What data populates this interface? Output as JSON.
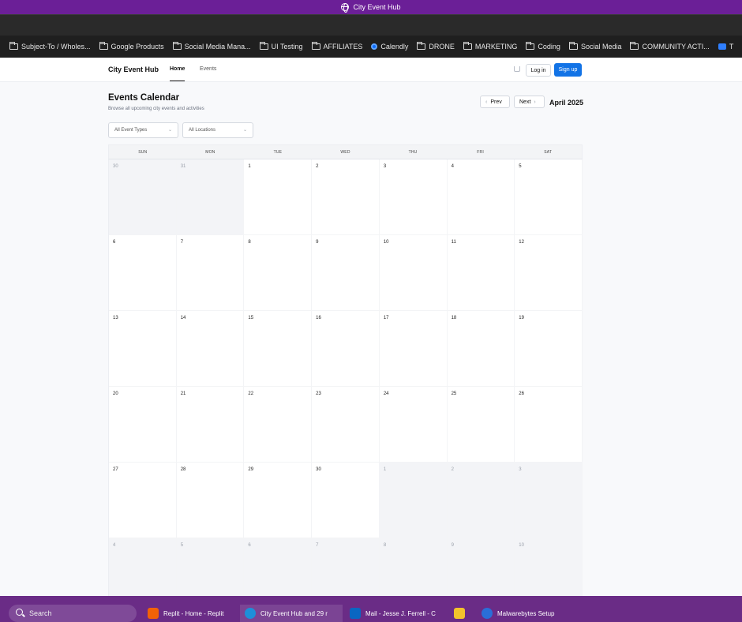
{
  "window": {
    "title": "City Event Hub"
  },
  "bookmarks": [
    {
      "label": "Subject-To / Wholes...",
      "icon": "folder-icon"
    },
    {
      "label": "Google Products",
      "icon": "folder-icon"
    },
    {
      "label": "Social Media Mana...",
      "icon": "folder-icon"
    },
    {
      "label": "UI Testing",
      "icon": "folder-icon"
    },
    {
      "label": "AFFILIATES",
      "icon": "folder-icon"
    },
    {
      "label": "Calendly",
      "icon": "calendly-icon"
    },
    {
      "label": "DRONE",
      "icon": "folder-icon"
    },
    {
      "label": "MARKETING",
      "icon": "folder-icon"
    },
    {
      "label": "Coding",
      "icon": "folder-icon"
    },
    {
      "label": "Social Media",
      "icon": "folder-icon"
    },
    {
      "label": "COMMUNITY ACTI...",
      "icon": "folder-icon"
    },
    {
      "label": "T",
      "icon": "chat-icon"
    }
  ],
  "nav": {
    "brand": "City Event Hub",
    "home": "Home",
    "events": "Events",
    "login": "Log in",
    "signup": "Sign up"
  },
  "calendar_header": {
    "title": "Events Calendar",
    "subtitle": "Browse all upcoming city events and activities",
    "prev": "Prev",
    "next": "Next",
    "month": "April 2025",
    "filter_type": "All Event Types",
    "filter_location": "All Locations"
  },
  "weekdays": [
    "SUN",
    "MON",
    "TUE",
    "WED",
    "THU",
    "FRI",
    "SAT"
  ],
  "days": [
    {
      "n": "30",
      "current": false
    },
    {
      "n": "31",
      "current": false
    },
    {
      "n": "1",
      "current": true
    },
    {
      "n": "2",
      "current": true
    },
    {
      "n": "3",
      "current": true
    },
    {
      "n": "4",
      "current": true
    },
    {
      "n": "5",
      "current": true
    },
    {
      "n": "6",
      "current": true
    },
    {
      "n": "7",
      "current": true
    },
    {
      "n": "8",
      "current": true
    },
    {
      "n": "9",
      "current": true
    },
    {
      "n": "10",
      "current": true
    },
    {
      "n": "11",
      "current": true
    },
    {
      "n": "12",
      "current": true
    },
    {
      "n": "13",
      "current": true
    },
    {
      "n": "14",
      "current": true
    },
    {
      "n": "15",
      "current": true
    },
    {
      "n": "16",
      "current": true
    },
    {
      "n": "17",
      "current": true
    },
    {
      "n": "18",
      "current": true
    },
    {
      "n": "19",
      "current": true
    },
    {
      "n": "20",
      "current": true
    },
    {
      "n": "21",
      "current": true
    },
    {
      "n": "22",
      "current": true
    },
    {
      "n": "23",
      "current": true
    },
    {
      "n": "24",
      "current": true
    },
    {
      "n": "25",
      "current": true
    },
    {
      "n": "26",
      "current": true
    },
    {
      "n": "27",
      "current": true
    },
    {
      "n": "28",
      "current": true
    },
    {
      "n": "29",
      "current": true
    },
    {
      "n": "30",
      "current": true
    },
    {
      "n": "1",
      "current": false
    },
    {
      "n": "2",
      "current": false
    },
    {
      "n": "3",
      "current": false
    },
    {
      "n": "4",
      "current": false
    },
    {
      "n": "5",
      "current": false
    },
    {
      "n": "6",
      "current": false
    },
    {
      "n": "7",
      "current": false
    },
    {
      "n": "8",
      "current": false
    },
    {
      "n": "9",
      "current": false
    },
    {
      "n": "10",
      "current": false
    }
  ],
  "taskbar": {
    "search": "Search",
    "items": [
      {
        "label": "Replit - Home - Replit",
        "icon": "replit-icon"
      },
      {
        "label": "City Event Hub and 29 r",
        "icon": "edge-icon"
      },
      {
        "label": "Mail - Jesse J. Ferrell - C",
        "icon": "mail-icon"
      },
      {
        "label": "",
        "icon": "file-explorer-icon"
      },
      {
        "label": "Malwarebytes Setup",
        "icon": "malwarebytes-icon"
      }
    ]
  },
  "colors": {
    "titlebar": "#6b1f97",
    "taskbar": "#6a2c86",
    "accent": "#1273e6"
  }
}
